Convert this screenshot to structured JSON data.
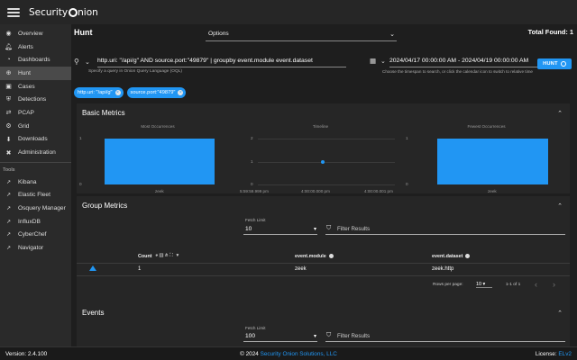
{
  "app": {
    "brand_prefix": "Security ",
    "brand_suffix": "nion"
  },
  "sidebar": {
    "items": [
      {
        "label": "Overview",
        "icon": "compass-icon"
      },
      {
        "label": "Alerts",
        "icon": "bell-icon"
      },
      {
        "label": "Dashboards",
        "icon": "dashboard-icon"
      },
      {
        "label": "Hunt",
        "icon": "crosshairs-icon"
      },
      {
        "label": "Cases",
        "icon": "briefcase-icon"
      },
      {
        "label": "Detections",
        "icon": "shield-icon"
      },
      {
        "label": "PCAP",
        "icon": "network-icon"
      },
      {
        "label": "Grid",
        "icon": "grid-icon"
      },
      {
        "label": "Downloads",
        "icon": "download-icon"
      },
      {
        "label": "Administration",
        "icon": "tools-icon"
      }
    ],
    "tools_heading": "Tools",
    "tools": [
      {
        "label": "Kibana"
      },
      {
        "label": "Elastic Fleet"
      },
      {
        "label": "Osquery Manager"
      },
      {
        "label": "InfluxDB"
      },
      {
        "label": "CyberChef"
      },
      {
        "label": "Navigator"
      }
    ]
  },
  "header": {
    "title": "Hunt",
    "options_label": "Options",
    "total_found": "Total Found: 1"
  },
  "query": {
    "text": "http.uri: \"/api/g\" AND source.port:\"49879\" | groupby event.module event.dataset",
    "hint": "Specify a query in Onion Query Language (OQL)"
  },
  "date_range": {
    "text": "2024/04/17 00:00:00 AM - 2024/04/19 00:00:00 AM",
    "hint": "Choose the timespan to search, or click the calendar icon to switch to relative time"
  },
  "hunt_button": "HUNT",
  "chips": [
    "http.uri: \"/api/g\"",
    "source.port:\"49879\""
  ],
  "basic_metrics": {
    "title": "Basic Metrics",
    "charts": [
      {
        "title": "Most Occurrences",
        "ymax": "1",
        "ymin": "0",
        "category": "zeek",
        "value": 1
      },
      {
        "title": "Timeline",
        "ymax": "2",
        "ymid": "1",
        "ymin": "0",
        "x_labels": [
          "5:59:59.999 pm",
          "4:00:00.000 pm",
          "4:00:00.001 pm"
        ],
        "point_value": 1
      },
      {
        "title": "Fewest Occurrences",
        "ymax": "1",
        "ymin": "0",
        "category": "zeek",
        "value": 1
      }
    ]
  },
  "group_metrics": {
    "title": "Group Metrics",
    "fetch_limit_label": "Fetch Limit",
    "fetch_limit": "10",
    "filter_placeholder": "Filter Results",
    "columns": {
      "count": "Count",
      "module": "event.module",
      "dataset": "event.dataset"
    },
    "rows": [
      {
        "count": "1",
        "module": "zeek",
        "dataset": "zeek.http"
      }
    ],
    "rows_per_page_label": "Rows per page:",
    "rows_per_page": "10",
    "page_info": "1-1 of 1"
  },
  "events": {
    "title": "Events",
    "fetch_limit_label": "Fetch Limit",
    "fetch_limit": "100",
    "filter_placeholder": "Filter Results"
  },
  "footer": {
    "version": "Version: 2.4.100",
    "copyright_prefix": "© 2024 ",
    "copyright_link": "Security Onion Solutions, LLC",
    "license_prefix": "License: ",
    "license_value": "ELv2"
  },
  "colors": {
    "accent": "#2196f3",
    "background": "#1e1e1e",
    "panel": "#262626"
  }
}
